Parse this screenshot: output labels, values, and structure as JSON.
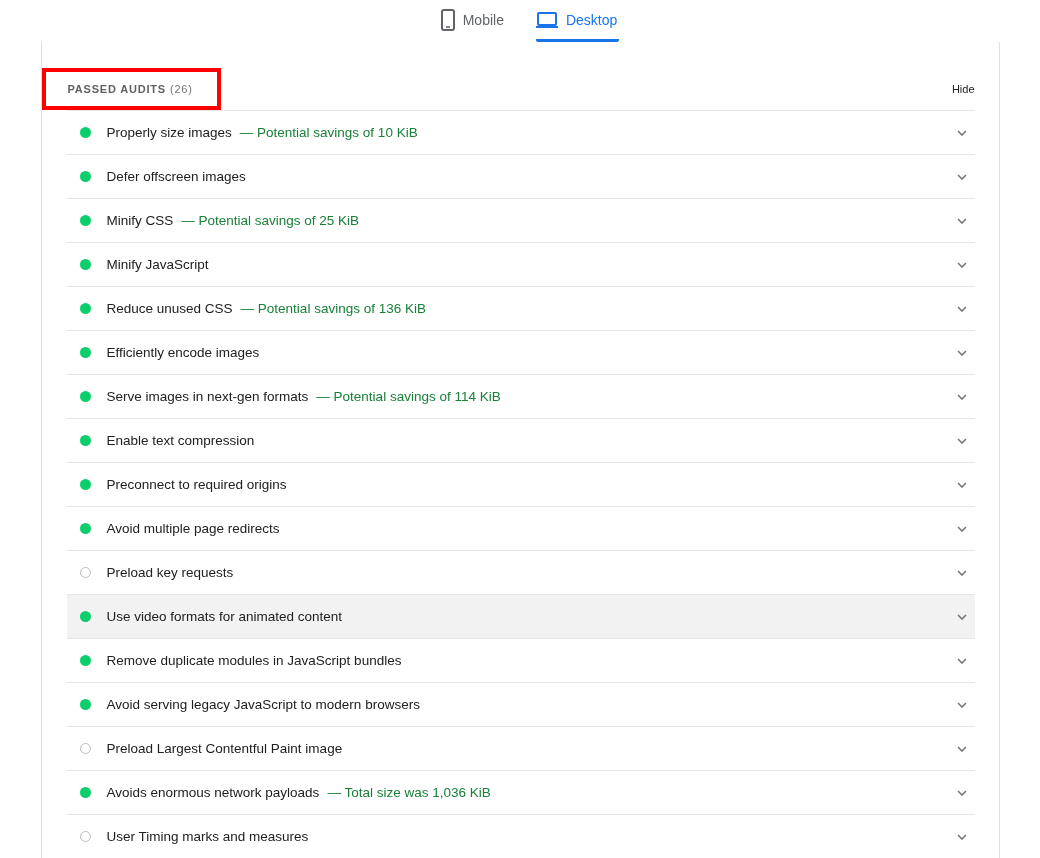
{
  "tabs": [
    {
      "label": "Mobile",
      "selected": false
    },
    {
      "label": "Desktop",
      "selected": true
    }
  ],
  "section": {
    "title": "PASSED AUDITS",
    "count": "(26)",
    "annotated": true,
    "toggle": "Hide"
  },
  "audits": [
    {
      "title": "Properly size images",
      "kind": "pass",
      "detail": "— Potential savings of 10 KiB",
      "highlighted": false
    },
    {
      "title": "Defer offscreen images",
      "kind": "pass",
      "highlighted": false
    },
    {
      "title": "Minify CSS",
      "kind": "pass",
      "detail": "— Potential savings of 25 KiB",
      "highlighted": false
    },
    {
      "title": "Minify JavaScript",
      "kind": "pass",
      "highlighted": false
    },
    {
      "title": "Reduce unused CSS",
      "kind": "pass",
      "detail": "— Potential savings of 136 KiB",
      "highlighted": false
    },
    {
      "title": "Efficiently encode images",
      "kind": "pass",
      "highlighted": false
    },
    {
      "title": "Serve images in next-gen formats",
      "kind": "pass",
      "detail": "— Potential savings of 114 KiB",
      "highlighted": false
    },
    {
      "title": "Enable text compression",
      "kind": "pass",
      "highlighted": false
    },
    {
      "title": "Preconnect to required origins",
      "kind": "pass",
      "highlighted": false
    },
    {
      "title": "Avoid multiple page redirects",
      "kind": "pass",
      "highlighted": false
    },
    {
      "title": "Preload key requests",
      "kind": "na",
      "highlighted": false
    },
    {
      "title": "Use video formats for animated content",
      "kind": "pass",
      "highlighted": true
    },
    {
      "title": "Remove duplicate modules in JavaScript bundles",
      "kind": "pass",
      "highlighted": false
    },
    {
      "title": "Avoid serving legacy JavaScript to modern browsers",
      "kind": "pass",
      "highlighted": false
    },
    {
      "title": "Preload Largest Contentful Paint image",
      "kind": "na",
      "highlighted": false
    },
    {
      "title": "Avoids enormous network payloads",
      "kind": "pass",
      "detail": "— Total size was 1,036 KiB",
      "highlighted": false
    },
    {
      "title": "User Timing marks and measures",
      "kind": "na",
      "highlighted": false
    }
  ]
}
